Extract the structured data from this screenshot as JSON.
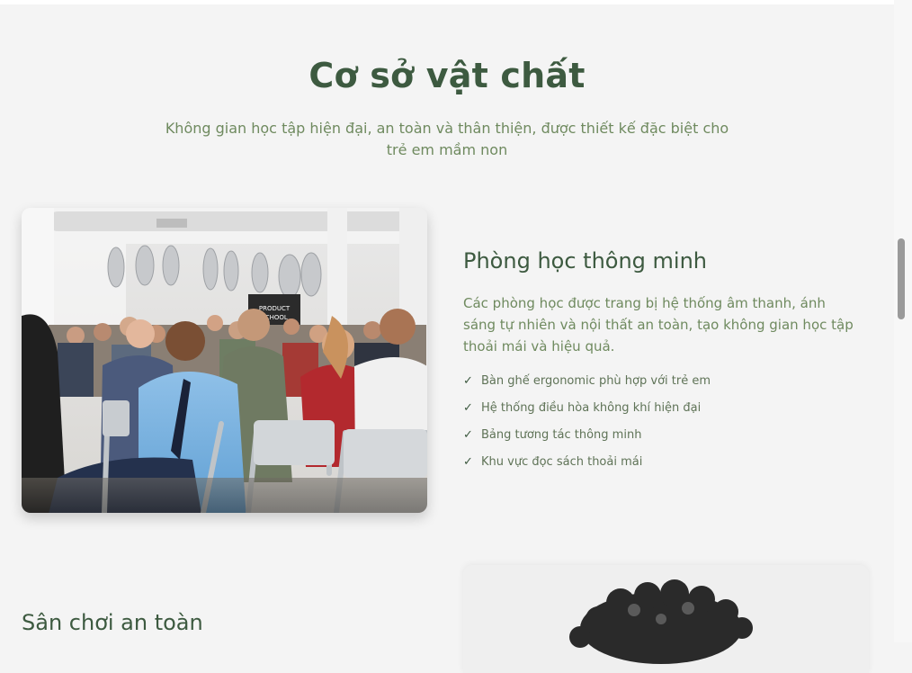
{
  "section": {
    "title": "Cơ sở vật chất",
    "subtitle": "Không gian học tập hiện đại, an toàn và thân thiện, được thiết kế đặc biệt cho trẻ em mầm non"
  },
  "features": [
    {
      "title": "Phòng học thông minh",
      "description": "Các phòng học được trang bị hệ thống âm thanh, ánh sáng tự nhiên và nội thất an toàn, tạo không gian học tập thoải mái và hiệu quả.",
      "items": [
        "Bàn ghế ergonomic phù hợp với trẻ em",
        "Hệ thống điều hòa không khí hiện đại",
        "Bảng tương tác thông minh",
        "Khu vực đọc sách thoải mái"
      ],
      "check_glyph": "✓",
      "photo_sign": [
        "PRODUCT",
        "SCHOOL"
      ]
    },
    {
      "title": "Sân chơi an toàn"
    }
  ],
  "colors": {
    "heading": "#3d5a40",
    "subtle_text": "#6f8a5f",
    "background": "#f4f4f4"
  }
}
